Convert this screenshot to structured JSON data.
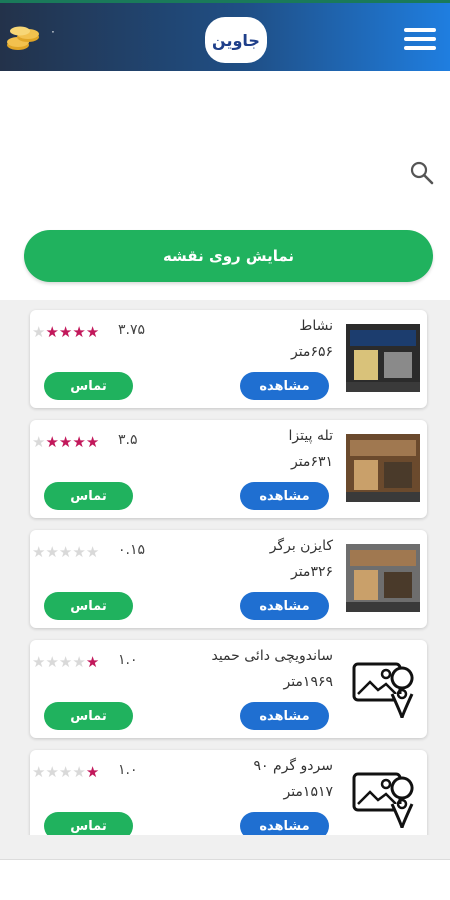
{
  "header": {
    "coin_count": "۰",
    "logo_text": "جاوین",
    "coins_icon": "coins-icon",
    "menu_icon": "hamburger-icon"
  },
  "search": {
    "icon": "search-icon"
  },
  "map_button_label": "نمایش روی نقشه",
  "colors": {
    "header_start": "#23324a",
    "header_end": "#1f7ee0",
    "primary_green": "#20b25e",
    "primary_blue": "#1f6fd1",
    "star_on": "#c2185b",
    "star_off": "#d9d9d9"
  },
  "places": [
    {
      "name": "نشاط",
      "distance": "۶۵۶متر",
      "rating": "۳.۷۵",
      "stars": 3.75,
      "thumb": "restaurant-photo",
      "view_label": "مشاهده",
      "call_label": "تماس"
    },
    {
      "name": "تله پیتزا",
      "distance": "۶۳۱متر",
      "rating": "۳.۵",
      "stars": 3.5,
      "thumb": "restaurant-photo",
      "view_label": "مشاهده",
      "call_label": "تماس"
    },
    {
      "name": "کایزن برگر",
      "distance": "۳۲۶متر",
      "rating": "۰.۱۵",
      "stars": 0.15,
      "thumb": "restaurant-photo",
      "view_label": "مشاهده",
      "call_label": "تماس"
    },
    {
      "name": "ساندویچی دائی حمید",
      "distance": "۱۹۶۹متر",
      "rating": "۱.۰",
      "stars": 1.0,
      "thumb": "image-placeholder-icon",
      "view_label": "مشاهده",
      "call_label": "تماس"
    },
    {
      "name": "سردو گرم ۹۰",
      "distance": "۱۵۱۷متر",
      "rating": "۱.۰",
      "stars": 1.0,
      "thumb": "image-placeholder-icon",
      "view_label": "مشاهده",
      "call_label": "تماس"
    }
  ]
}
